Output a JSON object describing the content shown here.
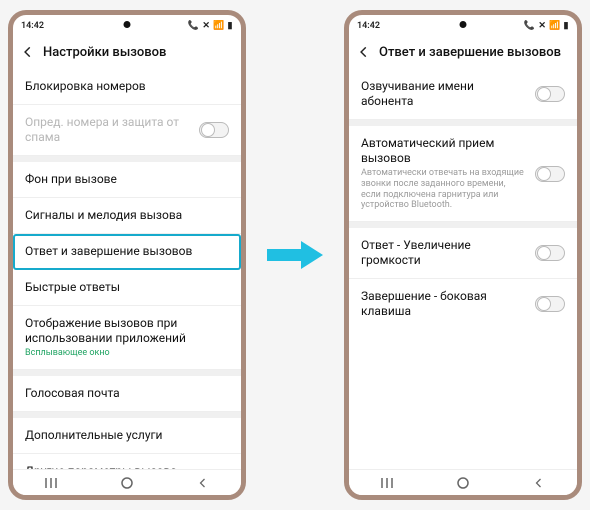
{
  "status": {
    "time": "14:42",
    "icons_left": "⚙ ◧ •",
    "icons_right": "📞 ✕ 📶 ▮"
  },
  "left_screen": {
    "title": "Настройки вызовов",
    "rows": [
      {
        "label": "Блокировка номеров",
        "type": "plain"
      },
      {
        "label": "Опред. номера и защита от спама",
        "type": "toggle",
        "disabled": true
      },
      {
        "gap": true
      },
      {
        "label": "Фон при вызове",
        "type": "plain"
      },
      {
        "label": "Сигналы и мелодия вызова",
        "type": "plain"
      },
      {
        "label": "Ответ и завершение вызовов",
        "type": "plain",
        "highlight": true
      },
      {
        "label": "Быстрые ответы",
        "type": "plain"
      },
      {
        "label": "Отображение вызовов при использовании приложений",
        "sub": "Всплывающее окно",
        "sub_green": true,
        "type": "plain"
      },
      {
        "gap": true
      },
      {
        "label": "Голосовая почта",
        "type": "plain"
      },
      {
        "gap": true
      },
      {
        "label": "Дополнительные услуги",
        "type": "plain"
      },
      {
        "label": "Другие параметры вызова",
        "type": "plain"
      }
    ]
  },
  "right_screen": {
    "title": "Ответ и завершение вызовов",
    "rows": [
      {
        "label": "Озвучивание имени абонента",
        "type": "toggle"
      },
      {
        "gap": true
      },
      {
        "label": "Автоматический прием вызовов",
        "sub": "Автоматически отвечать на входящие звонки после заданного времени, если подключена гарнитура или устройство Bluetooth.",
        "type": "toggle"
      },
      {
        "gap": true
      },
      {
        "label": "Ответ - Увеличение громкости",
        "type": "toggle"
      },
      {
        "label": "Завершение - боковая клавиша",
        "type": "toggle"
      }
    ]
  },
  "nav": {
    "recent": "|||",
    "home": "○",
    "back": "‹"
  },
  "colors": {
    "highlight": "#16aacc",
    "green": "#1fa362"
  }
}
